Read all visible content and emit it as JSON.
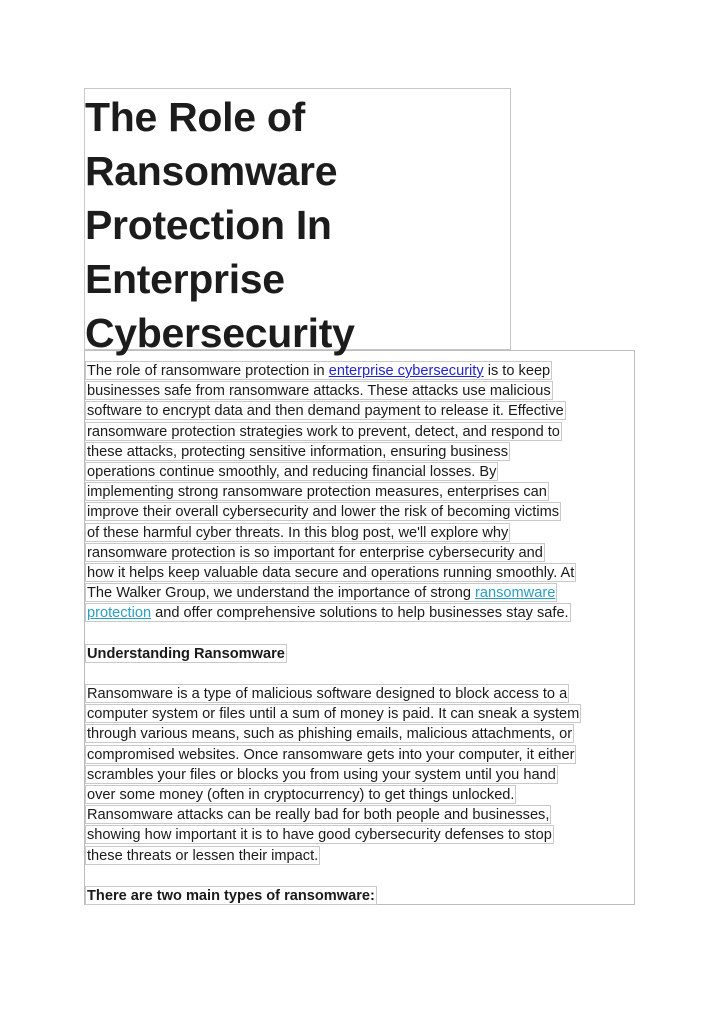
{
  "document": {
    "title": "The Role of Ransomware Protection In Enterprise Cybersecurity",
    "title_lines": [
      "The Role of",
      "Ransomware",
      "Protection In",
      "Enterprise",
      "Cybersecurity"
    ],
    "colors": {
      "page_background": "#ffffff",
      "text": "#1a1a1a",
      "title_text": "#1c1c1c",
      "box_border": "#c8c8c8",
      "line_border": "#c9c9c9",
      "link_blue": "#2323cf",
      "link_teal": "#2a9fc3"
    },
    "links": [
      {
        "text": "enterprise cybersecurity",
        "color": "blue"
      },
      {
        "text": "ransomware protection",
        "color": "teal"
      }
    ],
    "paragraph_1": {
      "lines": [
        [
          {
            "text": "The role of ransomware protection in ",
            "type": "text"
          },
          {
            "text": "enterprise cybersecurity",
            "type": "link",
            "color": "blue"
          },
          {
            "text": " is to keep",
            "type": "text"
          }
        ],
        [
          {
            "text": "businesses safe from ransomware attacks. These attacks use malicious",
            "type": "text"
          }
        ],
        [
          {
            "text": "software to encrypt data and then demand payment to release it. Effective",
            "type": "text"
          }
        ],
        [
          {
            "text": "ransomware protection strategies work to prevent, detect, and respond to",
            "type": "text"
          }
        ],
        [
          {
            "text": "these attacks, protecting sensitive information, ensuring business",
            "type": "text"
          }
        ],
        [
          {
            "text": "operations continue smoothly, and reducing financial losses. By",
            "type": "text"
          }
        ],
        [
          {
            "text": "implementing strong ransomware protection measures, enterprises can",
            "type": "text"
          }
        ],
        [
          {
            "text": "improve their overall cybersecurity and lower the risk of becoming victims",
            "type": "text"
          }
        ],
        [
          {
            "text": "of these harmful cyber threats. In this blog post, we'll explore why",
            "type": "text"
          }
        ],
        [
          {
            "text": "ransomware protection is so important for enterprise cybersecurity and",
            "type": "text"
          }
        ],
        [
          {
            "text": "how it helps keep valuable data secure and operations running smoothly. At",
            "type": "text"
          }
        ],
        [
          {
            "text": "The Walker Group, we understand the importance of strong ",
            "type": "text"
          },
          {
            "text": "ransomware",
            "type": "link",
            "color": "teal"
          }
        ],
        [
          {
            "text": "protection",
            "type": "link",
            "color": "teal"
          },
          {
            "text": " and offer comprehensive solutions to help businesses stay safe.",
            "type": "text"
          }
        ]
      ]
    },
    "heading_1": "Understanding Ransomware",
    "paragraph_2": {
      "lines": [
        [
          {
            "text": "Ransomware is a type of malicious software designed to block access to a",
            "type": "text"
          }
        ],
        [
          {
            "text": "computer system or files until a sum of money is paid. It can sneak a system",
            "type": "text"
          }
        ],
        [
          {
            "text": "through various means, such as phishing emails, malicious attachments, or",
            "type": "text"
          }
        ],
        [
          {
            "text": "compromised websites. Once ransomware gets into your computer, it either",
            "type": "text"
          }
        ],
        [
          {
            "text": "scrambles your files or blocks you from using your system until you hand",
            "type": "text"
          }
        ],
        [
          {
            "text": "over some money (often in cryptocurrency) to get things unlocked.",
            "type": "text"
          }
        ],
        [
          {
            "text": "Ransomware attacks can be really bad for both people and businesses,",
            "type": "text"
          }
        ],
        [
          {
            "text": "showing how important it is to have good cybersecurity defenses to stop",
            "type": "text"
          }
        ],
        [
          {
            "text": "these threats or lessen their impact.",
            "type": "text"
          }
        ]
      ]
    },
    "heading_2": "There are two main types of ransomware:"
  }
}
